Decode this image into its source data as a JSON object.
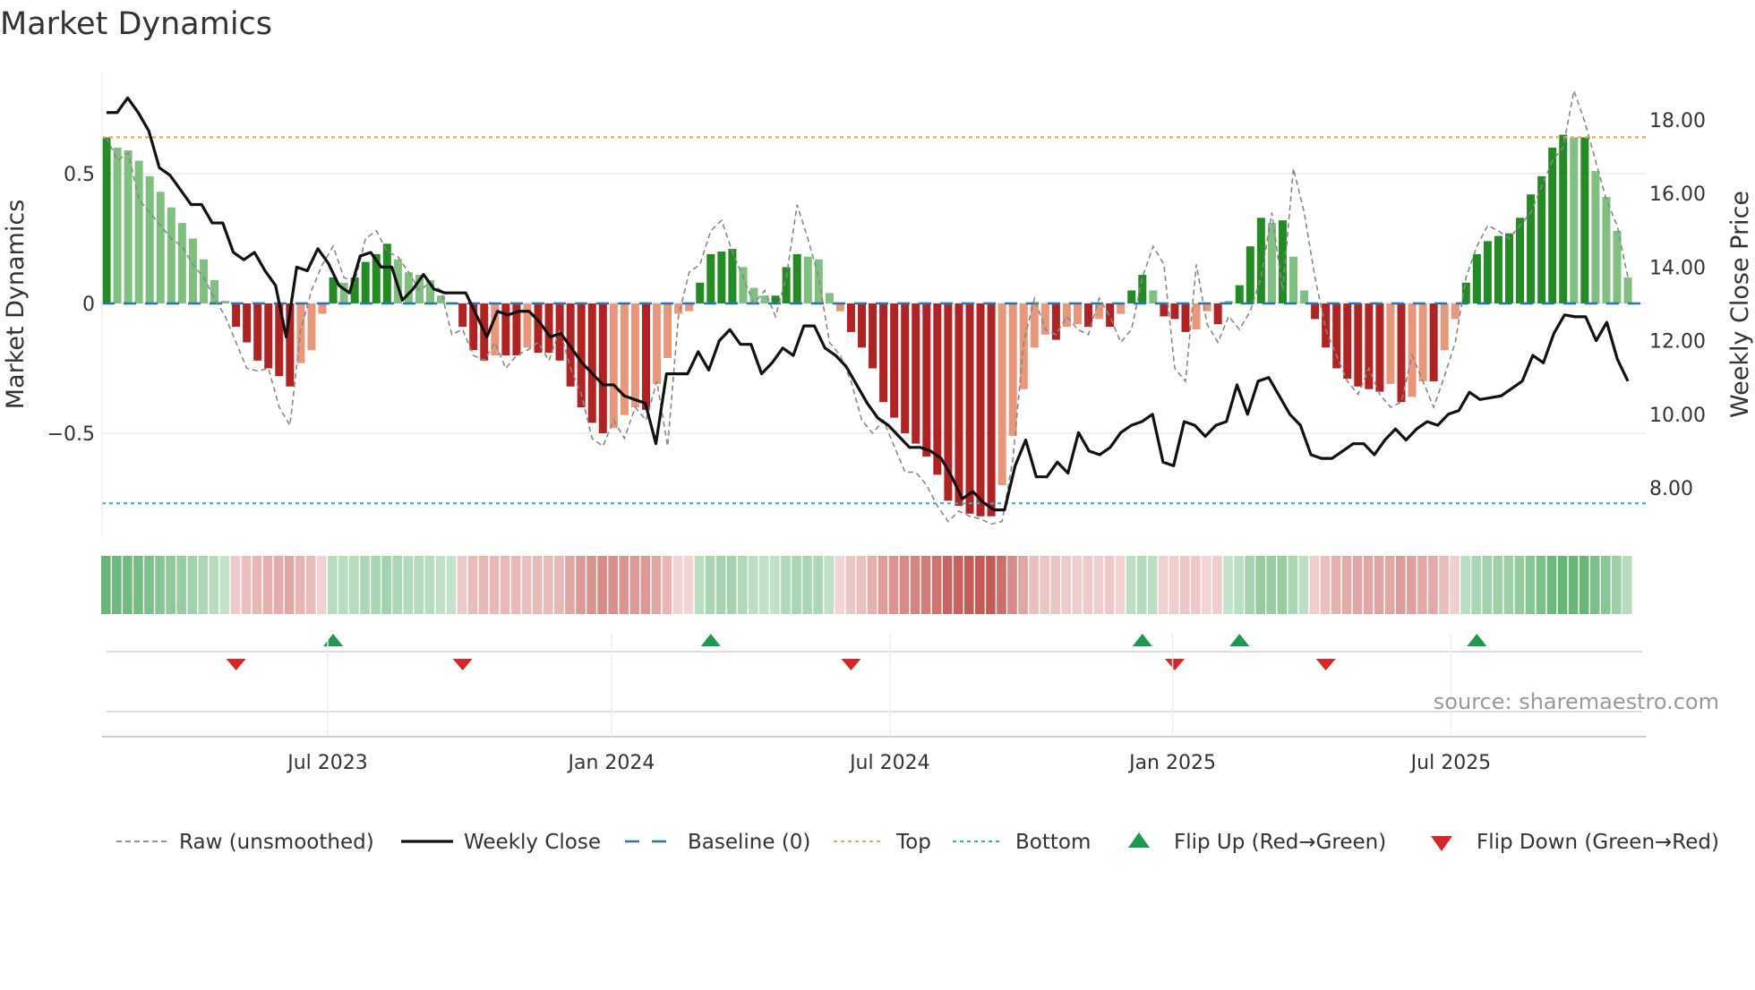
{
  "title": "Market Dynamics",
  "source": "source: sharemaestro.com",
  "colors": {
    "dark_green": "#228b22",
    "light_green": "#7fbf7f",
    "dark_red": "#b22222",
    "light_red": "#e9967a",
    "close": "#111111",
    "raw": "#888888",
    "baseline": "#1f77b4",
    "top": "#f4a460",
    "bottom": "#17becf",
    "flip_up": "#1a9a4a",
    "flip_down": "#d62728"
  },
  "chart_data": {
    "type": "bar",
    "title": "Market Dynamics",
    "ylabel": "Market Dynamics",
    "y2label": "Weekly Close Price",
    "ylim": [
      -0.72,
      0.95
    ],
    "y2lim": [
      7.0,
      19.0
    ],
    "yticks": [
      {
        "v": 0.5,
        "label": "0.5"
      },
      {
        "v": 0,
        "label": "0"
      },
      {
        "v": -0.5,
        "label": "−0.5"
      }
    ],
    "y2ticks": [
      {
        "v": 18,
        "label": "18.00"
      },
      {
        "v": 16,
        "label": "16.00"
      },
      {
        "v": 14,
        "label": "14.00"
      },
      {
        "v": 12,
        "label": "12.00"
      },
      {
        "v": 10,
        "label": "10.00"
      },
      {
        "v": 8,
        "label": "8.00"
      }
    ],
    "xticks": [
      {
        "x": 20.5,
        "label": "Jul 2023"
      },
      {
        "x": 46.8,
        "label": "Jan 2024"
      },
      {
        "x": 72.6,
        "label": "Jul 2024"
      },
      {
        "x": 98.8,
        "label": "Jan 2025"
      },
      {
        "x": 124.6,
        "label": "Jul 2025"
      }
    ],
    "top_level": 0.64,
    "bottom_level": -0.77,
    "baseline": 0,
    "smoothed": [
      0.64,
      0.6,
      0.59,
      0.55,
      0.49,
      0.43,
      0.37,
      0.31,
      0.25,
      0.17,
      0.09,
      0.01,
      -0.09,
      -0.15,
      -0.22,
      -0.25,
      -0.28,
      -0.32,
      -0.23,
      -0.18,
      -0.04,
      0.1,
      0.08,
      0.1,
      0.16,
      0.19,
      0.23,
      0.17,
      0.12,
      0.11,
      0.09,
      0.03,
      0.005,
      -0.09,
      -0.18,
      -0.22,
      -0.2,
      -0.2,
      -0.2,
      -0.17,
      -0.19,
      -0.19,
      -0.22,
      -0.32,
      -0.4,
      -0.46,
      -0.5,
      -0.48,
      -0.43,
      -0.4,
      -0.41,
      -0.31,
      -0.21,
      -0.04,
      -0.03,
      0.08,
      0.19,
      0.2,
      0.21,
      0.14,
      0.06,
      0.03,
      0.03,
      0.14,
      0.19,
      0.18,
      0.17,
      0.04,
      -0.03,
      -0.11,
      -0.17,
      -0.25,
      -0.38,
      -0.44,
      -0.5,
      -0.54,
      -0.59,
      -0.66,
      -0.76,
      -0.78,
      -0.81,
      -0.82,
      -0.82,
      -0.7,
      -0.51,
      -0.33,
      -0.17,
      -0.12,
      -0.14,
      -0.09,
      -0.08,
      -0.09,
      -0.06,
      -0.09,
      -0.04,
      0.05,
      0.11,
      0.05,
      -0.05,
      -0.06,
      -0.11,
      -0.1,
      -0.03,
      -0.08,
      0.01,
      0.07,
      0.22,
      0.33,
      0.31,
      0.32,
      0.18,
      0.05,
      -0.06,
      -0.17,
      -0.25,
      -0.29,
      -0.32,
      -0.33,
      -0.34,
      -0.31,
      -0.38,
      -0.36,
      -0.3,
      -0.3,
      -0.18,
      -0.06,
      0.08,
      0.19,
      0.24,
      0.26,
      0.27,
      0.33,
      0.42,
      0.49,
      0.6,
      0.65,
      0.64,
      0.64,
      0.51,
      0.41,
      0.28,
      0.1
    ],
    "raw": [
      0.64,
      0.55,
      0.58,
      0.4,
      0.35,
      0.3,
      0.25,
      0.22,
      0.15,
      0.1,
      0.02,
      -0.05,
      -0.15,
      -0.25,
      -0.26,
      -0.25,
      -0.4,
      -0.47,
      -0.1,
      0.05,
      0.15,
      0.22,
      0.1,
      0.08,
      0.25,
      0.28,
      0.2,
      0.18,
      0.12,
      0.05,
      0.08,
      0.05,
      -0.12,
      -0.1,
      -0.2,
      -0.22,
      -0.15,
      -0.25,
      -0.2,
      -0.18,
      -0.15,
      -0.22,
      -0.1,
      -0.25,
      -0.35,
      -0.52,
      -0.55,
      -0.45,
      -0.52,
      -0.4,
      -0.45,
      -0.3,
      -0.55,
      -0.05,
      0.12,
      0.15,
      0.28,
      0.32,
      0.2,
      0.1,
      0.0,
      0.05,
      -0.05,
      0.1,
      0.38,
      0.25,
      0.1,
      -0.15,
      -0.2,
      -0.3,
      -0.45,
      -0.5,
      -0.45,
      -0.55,
      -0.65,
      -0.65,
      -0.7,
      -0.78,
      -0.84,
      -0.8,
      -0.82,
      -0.83,
      -0.85,
      -0.84,
      -0.6,
      -0.15,
      0.02,
      -0.1,
      -0.12,
      -0.05,
      -0.1,
      -0.12,
      0.02,
      -0.05,
      -0.15,
      -0.1,
      0.1,
      0.22,
      0.15,
      -0.25,
      -0.3,
      0.15,
      -0.08,
      -0.15,
      -0.05,
      -0.1,
      -0.03,
      0.1,
      0.35,
      0.05,
      0.52,
      0.35,
      0.1,
      -0.1,
      -0.2,
      -0.3,
      -0.35,
      -0.25,
      -0.35,
      -0.4,
      -0.38,
      -0.2,
      -0.3,
      -0.4,
      -0.28,
      -0.15,
      0.1,
      0.22,
      0.3,
      0.28,
      0.25,
      0.3,
      0.35,
      0.45,
      0.55,
      0.6,
      0.82,
      0.7,
      0.55,
      0.4,
      0.3,
      0.1
    ],
    "close": [
      18.2,
      18.2,
      18.6,
      18.2,
      17.7,
      16.7,
      16.5,
      16.1,
      15.7,
      15.7,
      15.2,
      15.2,
      14.4,
      14.2,
      14.4,
      13.9,
      13.5,
      12.1,
      14.0,
      13.9,
      14.5,
      14.1,
      13.5,
      13.3,
      14.3,
      14.4,
      14.0,
      14.0,
      13.1,
      13.4,
      13.8,
      13.4,
      13.3,
      13.3,
      13.3,
      12.7,
      12.1,
      12.8,
      12.7,
      12.8,
      12.8,
      12.5,
      12.1,
      12.2,
      11.8,
      11.4,
      11.1,
      10.8,
      10.8,
      10.5,
      10.4,
      10.3,
      9.2,
      11.1,
      11.1,
      11.1,
      11.7,
      11.2,
      12.0,
      12.3,
      11.9,
      11.9,
      11.1,
      11.4,
      11.8,
      11.6,
      12.4,
      12.4,
      11.8,
      11.6,
      11.3,
      10.8,
      10.3,
      9.9,
      9.7,
      9.4,
      9.1,
      9.1,
      9.0,
      8.8,
      8.3,
      7.7,
      7.9,
      7.6,
      7.4,
      7.4,
      8.6,
      9.3,
      8.3,
      8.3,
      8.7,
      8.4,
      9.5,
      9.0,
      8.9,
      9.1,
      9.5,
      9.7,
      9.8,
      10.0,
      8.7,
      8.6,
      9.8,
      9.7,
      9.4,
      9.7,
      9.8,
      10.8,
      10.0,
      10.9,
      11.0,
      10.5,
      10.0,
      9.7,
      8.9,
      8.8,
      8.8,
      9.0,
      9.2,
      9.2,
      8.9,
      9.3,
      9.6,
      9.3,
      9.6,
      9.8,
      9.7,
      10.0,
      10.1,
      10.6,
      10.4,
      10.45,
      10.5,
      10.7,
      10.9,
      11.6,
      11.4,
      12.2,
      12.7,
      12.65,
      12.65,
      12.0,
      12.5,
      11.5,
      10.9
    ],
    "flip_up": [
      21,
      56,
      96,
      105,
      127
    ],
    "flip_down": [
      12,
      33,
      69,
      99,
      113
    ],
    "legend": {
      "position": "bottom",
      "items": [
        {
          "key": "raw",
          "label": "Raw (unsmoothed)"
        },
        {
          "key": "close",
          "label": "Weekly Close"
        },
        {
          "key": "baseline",
          "label": "Baseline (0)"
        },
        {
          "key": "top",
          "label": "Top"
        },
        {
          "key": "bottom",
          "label": "Bottom"
        },
        {
          "key": "flip_up",
          "label": "Flip Up (Red→Green)"
        },
        {
          "key": "flip_down",
          "label": "Flip Down (Green→Red)"
        }
      ]
    }
  }
}
